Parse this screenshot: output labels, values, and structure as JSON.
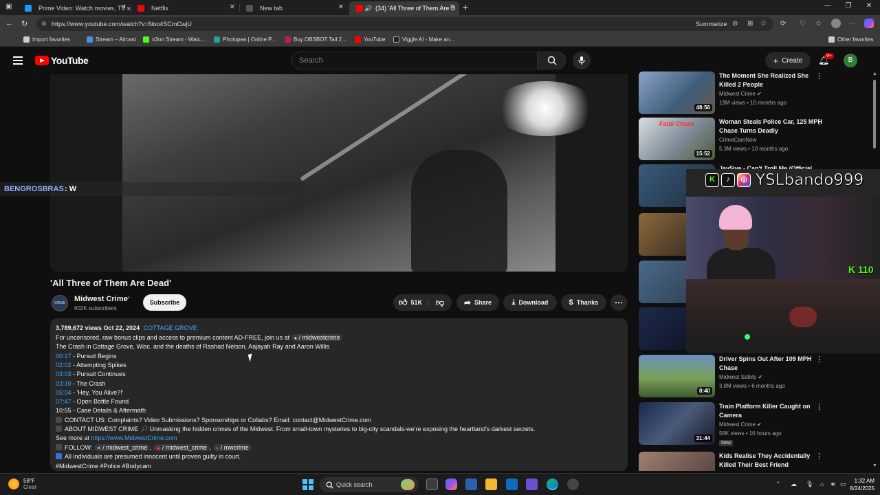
{
  "browser": {
    "tabs": [
      {
        "label": "Prime Video: Watch movies, TV sh",
        "color": "#1a98ff"
      },
      {
        "label": "Netflix",
        "color": "#e50914"
      },
      {
        "label": "New tab",
        "color": "#888888"
      },
      {
        "label": "(34) 'All Three of Them Are D",
        "color": "#ff0000"
      }
    ],
    "url": "https://www.youtube.com/watch?v=Noo4SCmCwjU",
    "summarize_label": "Summarize",
    "favorites": [
      {
        "label": "Import favorites",
        "color": "#cccccc"
      },
      {
        "label": "Stream – Aircast",
        "color": "#4a90e2"
      },
      {
        "label": "n3on Stream - Watc...",
        "color": "#53fc18"
      },
      {
        "label": "Photopea | Online P...",
        "color": "#18a497"
      },
      {
        "label": "Buy OBSBOT Tail 2...",
        "color": "#c2185b"
      },
      {
        "label": "YouTube",
        "color": "#ff0000"
      },
      {
        "label": "Viggle AI - Make an...",
        "color": "#222222"
      }
    ],
    "other_favorites": "Other favorites"
  },
  "youtube": {
    "logo_text": "YouTube",
    "search_placeholder": "Search",
    "create_label": "Create",
    "notif_count": "9+",
    "avatar_letter": "B"
  },
  "video": {
    "chat_name": "BENGROSBRAS",
    "chat_message": ": W",
    "title": "'All Three of Them Are Dead'",
    "channel_name": "Midwest Crime",
    "channel_logo_text": "CRIME",
    "subscribers": "602K subscribers",
    "subscribe_label": "Subscribe",
    "likes": "51K",
    "share_label": "Share",
    "download_label": "Download",
    "thanks_label": "Thanks"
  },
  "description": {
    "views_date": "3,789,672 views  Oct 22, 2024",
    "location": "COTTAGE GROVE",
    "promo": "For uncensored, raw bonus clips and access to premium content AD-FREE, join us at",
    "promo_link": "/ midwestcrime",
    "summary": "The Crash in Cottage Grove, Wisc. and the deaths of Rashad Nelson, Aajayah Ray and Aaron Willis",
    "chapters": [
      {
        "time": "00:17",
        "label": " - Pursuit Begins"
      },
      {
        "time": "02:02",
        "label": " - Attempting Spikes"
      },
      {
        "time": "03:03",
        "label": " - Pursuit Continues"
      },
      {
        "time": "03:30",
        "label": " - The Crash"
      },
      {
        "time": "05:04",
        "label": " - 'Hey, You Alive?!'"
      },
      {
        "time": "07:47",
        "label": " - Open Bottle Found"
      }
    ],
    "last_chapter": "10:55 - Case Details & Aftermath",
    "contact": "CONTACT US: Complaints? Video Submissions? Sponsorships or Collabs? Email: contact@MidwestCrime.com",
    "about": "ABOUT MIDWEST CRIME",
    "about_text": "Unmasking the hidden crimes of the Midwest. From small-town mysteries to big-city scandals-we're exposing the heartland's darkest secrets.",
    "see_more": "See more at",
    "see_more_link": "https://www.MidwestCrime.com",
    "follow_label": "FOLLOW:",
    "follow_1": "/ midwest_crime",
    "follow_2": "/ midwest_crime",
    "follow_3": "/ mwcrime",
    "innocent": "All individuals are presumed innocent until proven guilty in court.",
    "hashtags": "#MidwestCrime #Police #Bodycam"
  },
  "sidebar": [
    {
      "title": "The Moment She Realized She Killed 2 People",
      "channel": "Midwest Crime",
      "verified": true,
      "meta": "19M views • 10 months ago",
      "duration": "48:56",
      "thumb": "linear-gradient(135deg,#8aa4c8,#3e5c7a 60%,#6b5a4a)"
    },
    {
      "title": "Woman Steals Police Car, 125 MPH Chase Turns Deadly",
      "channel": "CrimeCamNow",
      "verified": false,
      "meta": "5.3M views • 10 months ago",
      "duration": "15:52",
      "thumb": "linear-gradient(135deg,#d8dde3,#7e8b96 55%,#4f5a3c)"
    },
    {
      "title": "Jay5ive - Can't Troll Me (Official",
      "channel": "",
      "verified": false,
      "meta": "",
      "duration": "",
      "thumb": "linear-gradient(135deg,#3a5a7a,#1e2e3e)"
    },
    {
      "title": "",
      "channel": "",
      "verified": false,
      "meta": "",
      "duration": "",
      "thumb": "linear-gradient(135deg,#8a6a3a,#2a2020)"
    },
    {
      "title": "",
      "channel": "",
      "verified": false,
      "meta": "",
      "duration": "",
      "thumb": "linear-gradient(135deg,#4a6a8a,#2a3a4a)"
    },
    {
      "title": "",
      "channel": "",
      "verified": false,
      "meta": "",
      "duration": "",
      "thumb": "linear-gradient(135deg,#1e2a4a,#0a0f1e)"
    },
    {
      "title": "Driver Spins Out After 109 MPH Chase",
      "channel": "Midwest Safety",
      "verified": true,
      "meta": "3.8M views • 6 months ago",
      "duration": "8:40",
      "thumb": "linear-gradient(180deg,#6a8fc0,#7aa05a 55%,#3e5a2e)"
    },
    {
      "title": "Train Platform Killer Caught on Camera",
      "channel": "Midwest Crime",
      "verified": true,
      "meta": "56K views • 10 hours ago",
      "duration": "31:44",
      "thumb": "linear-gradient(135deg,#1a2a4a,#4a5a7a 50%,#1a1a2a)",
      "new_badge": "New"
    },
    {
      "title": "Kids Realise They Accidentally Killed Their Best Friend",
      "channel": "",
      "verified": false,
      "meta": "",
      "duration": "",
      "thumb": "linear-gradient(135deg,#a08070,#4a3a3a)"
    }
  ],
  "webcam": {
    "name": "YSLbando999",
    "kick_count": "110"
  },
  "taskbar": {
    "temp": "58°F",
    "condition": "Clear",
    "search_label": "Quick search",
    "time": "1:32 AM",
    "date": "8/24/2025"
  }
}
